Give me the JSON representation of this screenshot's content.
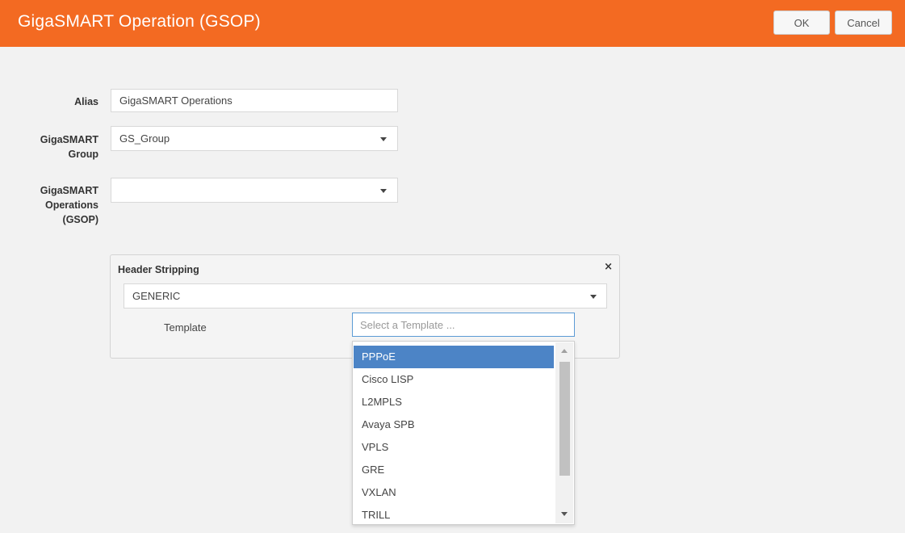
{
  "header": {
    "title": "GigaSMART Operation (GSOP)",
    "ok_label": "OK",
    "cancel_label": "Cancel"
  },
  "form": {
    "alias_label": "Alias",
    "alias_value": "GigaSMART Operations",
    "group_label_line1": "GigaSMART",
    "group_label_line2": "Group",
    "group_value": "GS_Group",
    "gsop_label_line1": "GigaSMART",
    "gsop_label_line2": "Operations",
    "gsop_label_line3": "(GSOP)",
    "gsop_value": ""
  },
  "panel": {
    "title": "Header Stripping",
    "close_glyph": "×",
    "type_value": "GENERIC",
    "template_label": "Template",
    "template_placeholder": "Select a Template ..."
  },
  "dropdown": {
    "options": [
      "PPPoE",
      "Cisco LISP",
      "L2MPLS",
      "Avaya SPB",
      "VPLS",
      "GRE",
      "VXLAN",
      "TRILL"
    ],
    "selected": "PPPoE"
  },
  "colors": {
    "header": "#f36a22",
    "selection": "#4c84c6",
    "focus": "#5b9bd5"
  },
  "icons": {
    "caret": "chevron-down-icon",
    "close": "close-icon"
  }
}
